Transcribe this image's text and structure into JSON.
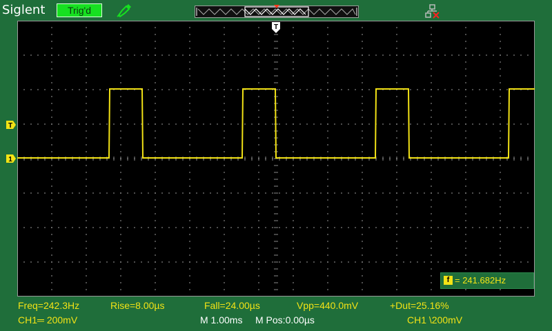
{
  "header": {
    "brand": "Siglent",
    "trigger_status": "Trig'd"
  },
  "markers": {
    "trigger_position": "T",
    "trigger_level": "T",
    "channel1": "1"
  },
  "colors": {
    "background": "#1f6e3a",
    "channel1": "#f3e316",
    "trigger_badge": "#17e021",
    "grid": "#8a8a8a"
  },
  "icons": {
    "probe": "pen-icon",
    "network": "network-disconnected-icon"
  },
  "frequency_counter": {
    "icon_label": "f",
    "value": "= 241.682Hz"
  },
  "measurements": {
    "freq": "Freq=242.3Hz",
    "rise": "Rise=8.00µs",
    "fall": "Fall=24.00µs",
    "vpp": "Vpp=440.0mV",
    "duty": "+Dut=25.16%"
  },
  "status": {
    "ch1_scale": "CH1═ 200mV",
    "timebase": "M 1.00ms",
    "mpos": "M Pos:0.00µs",
    "trigger": "CH1 \\200mV"
  }
}
